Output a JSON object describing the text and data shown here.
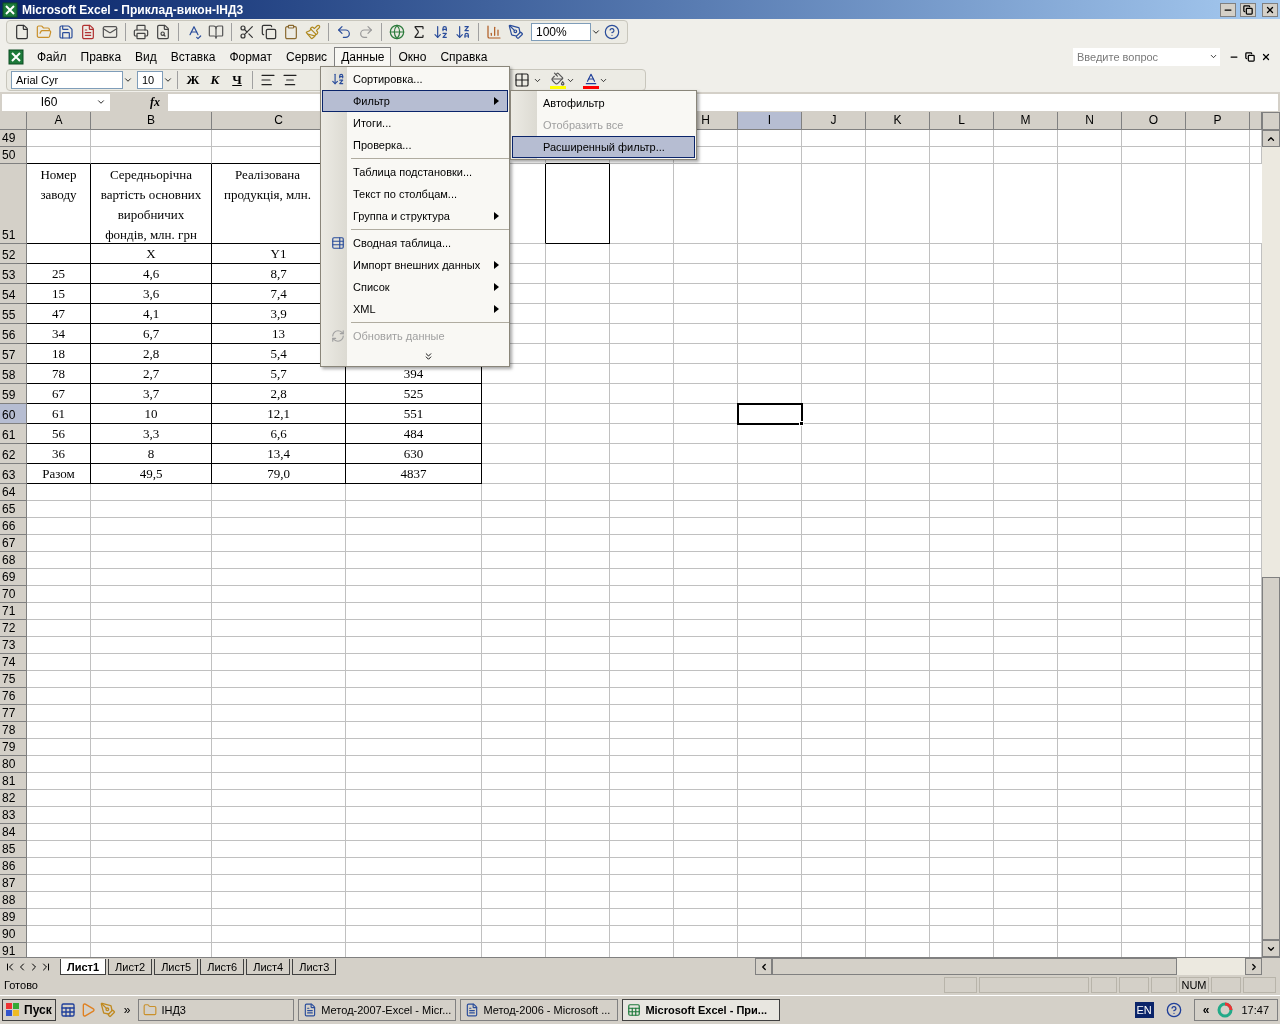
{
  "window": {
    "title": "Microsoft Excel - Приклад-викон-ІНД3"
  },
  "toolbar": {
    "zoom": "100%"
  },
  "menu_bar": [
    {
      "label": "Файл",
      "selected": false
    },
    {
      "label": "Правка",
      "selected": false
    },
    {
      "label": "Вид",
      "selected": false
    },
    {
      "label": "Вставка",
      "selected": false
    },
    {
      "label": "Формат",
      "selected": false
    },
    {
      "label": "Сервис",
      "selected": false
    },
    {
      "label": "Данные",
      "selected": true
    },
    {
      "label": "Окно",
      "selected": false
    },
    {
      "label": "Справка",
      "selected": false
    }
  ],
  "question_box": {
    "placeholder": "Введите вопрос"
  },
  "formatting": {
    "font": "Arial Cyr",
    "size": "10",
    "buttons": [
      "Ж",
      "К",
      "Ч"
    ]
  },
  "name_box": {
    "value": "I60"
  },
  "formula_bar": {
    "label": "fx"
  },
  "columns": [
    {
      "label": "A",
      "selected": false
    },
    {
      "label": "B",
      "selected": false
    },
    {
      "label": "C",
      "selected": false
    },
    {
      "label": "H",
      "selected": false
    },
    {
      "label": "I",
      "selected": true
    },
    {
      "label": "J",
      "selected": false
    },
    {
      "label": "K",
      "selected": false
    },
    {
      "label": "L",
      "selected": false
    },
    {
      "label": "M",
      "selected": false
    },
    {
      "label": "N",
      "selected": false
    },
    {
      "label": "O",
      "selected": false
    },
    {
      "label": "P",
      "selected": false
    }
  ],
  "row_numbers": [
    {
      "label": "49",
      "selected": false
    },
    {
      "label": "50",
      "selected": false
    },
    {
      "label": "51",
      "selected": false
    },
    {
      "label": "52",
      "selected": false
    },
    {
      "label": "53",
      "selected": false
    },
    {
      "label": "54",
      "selected": false
    },
    {
      "label": "55",
      "selected": false
    },
    {
      "label": "56",
      "selected": false
    },
    {
      "label": "57",
      "selected": false
    },
    {
      "label": "58",
      "selected": false
    },
    {
      "label": "59",
      "selected": false
    },
    {
      "label": "60",
      "selected": true
    },
    {
      "label": "61",
      "selected": false
    },
    {
      "label": "62",
      "selected": false
    },
    {
      "label": "63",
      "selected": false
    },
    {
      "label": "64",
      "selected": false
    },
    {
      "label": "65",
      "selected": false
    },
    {
      "label": "66",
      "selected": false
    },
    {
      "label": "67",
      "selected": false
    },
    {
      "label": "68",
      "selected": false
    },
    {
      "label": "69",
      "selected": false
    },
    {
      "label": "70",
      "selected": false
    },
    {
      "label": "71",
      "selected": false
    },
    {
      "label": "72",
      "selected": false
    },
    {
      "label": "73",
      "selected": false
    },
    {
      "label": "74",
      "selected": false
    },
    {
      "label": "75",
      "selected": false
    },
    {
      "label": "76",
      "selected": false
    },
    {
      "label": "77",
      "selected": false
    },
    {
      "label": "78",
      "selected": false
    },
    {
      "label": "79",
      "selected": false
    },
    {
      "label": "80",
      "selected": false
    },
    {
      "label": "81",
      "selected": false
    },
    {
      "label": "82",
      "selected": false
    },
    {
      "label": "83",
      "selected": false
    },
    {
      "label": "84",
      "selected": false
    },
    {
      "label": "85",
      "selected": false
    },
    {
      "label": "86",
      "selected": false
    },
    {
      "label": "87",
      "selected": false
    },
    {
      "label": "88",
      "selected": false
    },
    {
      "label": "89",
      "selected": false
    },
    {
      "label": "90",
      "selected": false
    },
    {
      "label": "91",
      "selected": false
    }
  ],
  "table": {
    "headers": [
      "Номер заводу",
      "Середньорічна вартість основних виробничих фондів, млн. грн",
      "Реалізована продукція, млн."
    ],
    "symbols": [
      "X",
      "Y1"
    ],
    "rows": [
      [
        "25",
        "4,6",
        "8,7"
      ],
      [
        "15",
        "3,6",
        "7,4"
      ],
      [
        "47",
        "4,1",
        "3,9"
      ],
      [
        "34",
        "6,7",
        "13"
      ],
      [
        "18",
        "2,8",
        "5,4"
      ],
      [
        "78",
        "2,7",
        "5,7",
        "394"
      ],
      [
        "67",
        "3,7",
        "2,8",
        "525"
      ],
      [
        "61",
        "10",
        "12,1",
        "551"
      ],
      [
        "56",
        "3,3",
        "6,6",
        "484"
      ],
      [
        "36",
        "8",
        "13,4",
        "630"
      ]
    ],
    "total": [
      "Разом",
      "49,5",
      "79,0",
      "4837"
    ]
  },
  "data_menu": [
    {
      "kind": "command",
      "label": "Сортировка...",
      "selected": false,
      "disabled": false
    },
    {
      "kind": "submenu",
      "label": "Фильтр",
      "selected": true,
      "disabled": false
    },
    {
      "kind": "command",
      "label": "Итоги...",
      "selected": false,
      "disabled": false
    },
    {
      "kind": "command",
      "label": "Проверка...",
      "selected": false,
      "disabled": false
    },
    {
      "kind": "separator"
    },
    {
      "kind": "command",
      "label": "Таблица подстановки...",
      "selected": false,
      "disabled": false
    },
    {
      "kind": "command",
      "label": "Текст по столбцам...",
      "selected": false,
      "disabled": false
    },
    {
      "kind": "submenu",
      "label": "Группа и структура",
      "selected": false,
      "disabled": false
    },
    {
      "kind": "separator"
    },
    {
      "kind": "command",
      "label": "Сводная таблица...",
      "selected": false,
      "disabled": false
    },
    {
      "kind": "submenu",
      "label": "Импорт внешних данных",
      "selected": false,
      "disabled": false
    },
    {
      "kind": "submenu",
      "label": "Список",
      "selected": false,
      "disabled": false
    },
    {
      "kind": "submenu",
      "label": "XML",
      "selected": false,
      "disabled": false
    },
    {
      "kind": "separator"
    },
    {
      "kind": "command",
      "label": "Обновить данные",
      "selected": false,
      "disabled": true
    },
    {
      "kind": "expand"
    }
  ],
  "filter_submenu": [
    {
      "label": "Автофильтр",
      "selected": false,
      "disabled": false
    },
    {
      "label": "Отобразить все",
      "selected": false,
      "disabled": true
    },
    {
      "label": "Расширенный фильтр...",
      "selected": true,
      "disabled": false
    }
  ],
  "sheet_tabs": [
    {
      "label": "Лист1",
      "selected": true
    },
    {
      "label": "Лист2",
      "selected": false
    },
    {
      "label": "Лист5",
      "selected": false
    },
    {
      "label": "Лист6",
      "selected": false
    },
    {
      "label": "Лист4",
      "selected": false
    },
    {
      "label": "Лист3",
      "selected": false
    }
  ],
  "status_bar": {
    "text": "Готово",
    "indicators": [
      "NUM"
    ]
  },
  "taskbar": {
    "start": "Пуск",
    "more": "»",
    "tasks": [
      {
        "label": "ІНД3",
        "kind": "folder",
        "selected": false
      },
      {
        "label": "Метод-2007-Excel - Micr...",
        "kind": "word",
        "selected": false
      },
      {
        "label": "Метод-2006 - Microsoft ...",
        "kind": "word",
        "selected": false
      },
      {
        "label": "Microsoft Excel - При...",
        "kind": "excel",
        "selected": true
      }
    ],
    "language": "EN",
    "tray_more": "«",
    "clock": "17:47"
  }
}
